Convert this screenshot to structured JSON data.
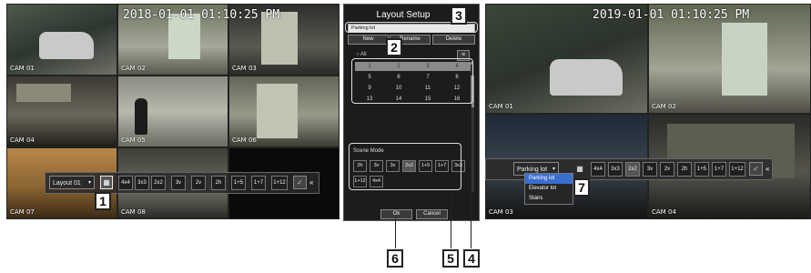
{
  "left": {
    "timestamp": "2018-01-01 01:10:25 PM",
    "cams": [
      "CAM 01",
      "CAM 02",
      "CAM 03",
      "CAM 04",
      "CAM 05",
      "CAM 06",
      "CAM 07",
      "CAM 08"
    ],
    "toolbar": {
      "layout_label": "Layout 01",
      "buttons": [
        "4x4",
        "3x3",
        "2x2",
        "3v",
        "2v",
        "2h",
        "1+5",
        "1+7",
        "1+12"
      ],
      "more": "«"
    }
  },
  "middle": {
    "title": "Layout Setup",
    "layout_name": "Parking lot",
    "new_label": "New",
    "rename_label": "Rename",
    "delete_label": "Delete",
    "all_label": "All",
    "numbers": [
      "1",
      "2",
      "3",
      "4",
      "5",
      "6",
      "7",
      "8",
      "9",
      "10",
      "11",
      "12",
      "13",
      "14",
      "15",
      "16"
    ],
    "scene_mode_label": "Scene Mode",
    "scene_buttons": [
      "2h",
      "3v",
      "3x",
      "2x2",
      "1+5",
      "1+7",
      "3x3",
      "1+12",
      "4x4"
    ],
    "ok_label": "Ok",
    "cancel_label": "Cancel"
  },
  "right": {
    "timestamp": "2019-01-01 01:10:25 PM",
    "cams": [
      "CAM 01",
      "CAM 02",
      "CAM 03",
      "CAM 04"
    ],
    "toolbar": {
      "select_value": "Parking lot",
      "buttons": [
        "4x4",
        "3x3",
        "2x2",
        "3v",
        "2v",
        "2h",
        "1+5",
        "1+7",
        "1+12"
      ],
      "more": "«"
    },
    "dropdown": [
      "Parking lot",
      "Elevator lot",
      "Stairs"
    ]
  },
  "callouts": [
    "1",
    "2",
    "3",
    "4",
    "5",
    "6",
    "7"
  ]
}
